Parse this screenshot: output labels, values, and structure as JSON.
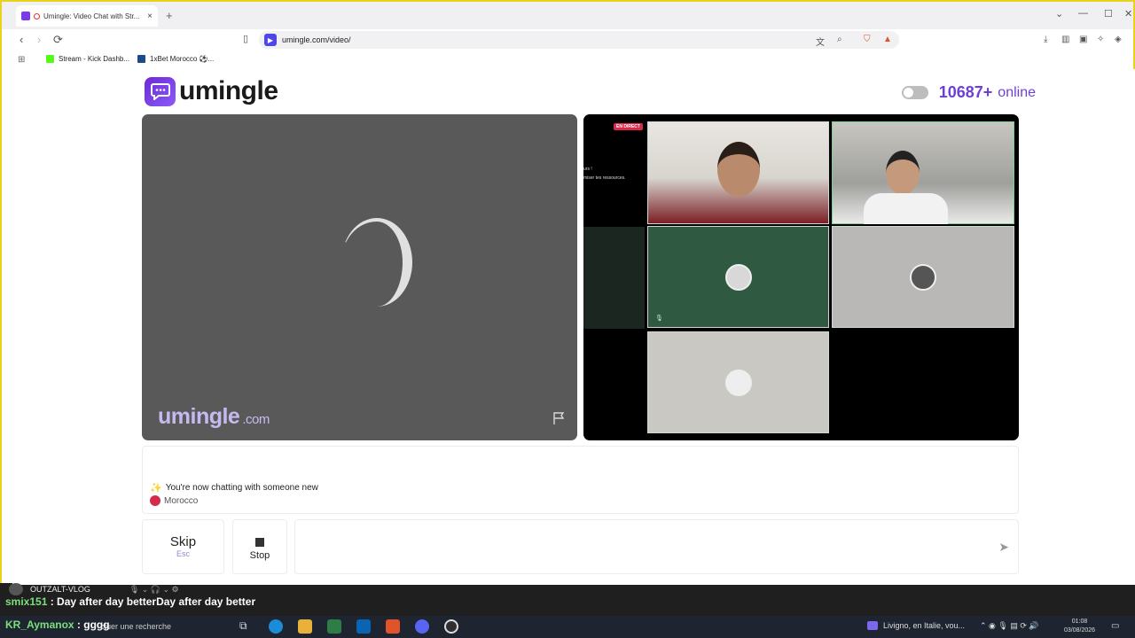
{
  "browser": {
    "tab_title": "Umingle: Video Chat with Str...",
    "tab_close": "×",
    "new_tab": "+",
    "url": "umingle.com/video/",
    "nav": {
      "back": "‹",
      "forward": "›",
      "reload": "⟳"
    },
    "bookmarks": [
      {
        "label": "Stream - Kick Dashb...",
        "color": "#53fc18"
      },
      {
        "label": "1xBet Morocco ⚽...",
        "color": "#1b4b8a"
      }
    ]
  },
  "site": {
    "logo_text": "umingle",
    "online_count": "10687+",
    "online_label": "online",
    "watermark": "umingle",
    "watermark_suffix": ".com",
    "live_badge": "EN DIRECT",
    "side_text_1": "urs !",
    "side_text_2": "miser tes ressources."
  },
  "chat": {
    "message": "You're now chatting with someone new",
    "country": "Morocco"
  },
  "controls": {
    "skip_label": "Skip",
    "skip_hint": "Esc",
    "stop_label": "Stop",
    "send": "➤"
  },
  "overlay": {
    "streamer": "OUTZALT-VLOG",
    "msg1_user": "smix151",
    "msg1_text": ": Day after day betterDay after day better",
    "msg2_user": "KR_Aymanox",
    "msg2_text": ": gggg"
  },
  "taskbar": {
    "search": "ctuer une recherche",
    "weather": "Livigno, en Italie, vou...",
    "time": "01:08",
    "date": "03/08/2026"
  },
  "colors": {
    "brand": "#6d3fd6",
    "country_dot": "#d62a4a"
  }
}
